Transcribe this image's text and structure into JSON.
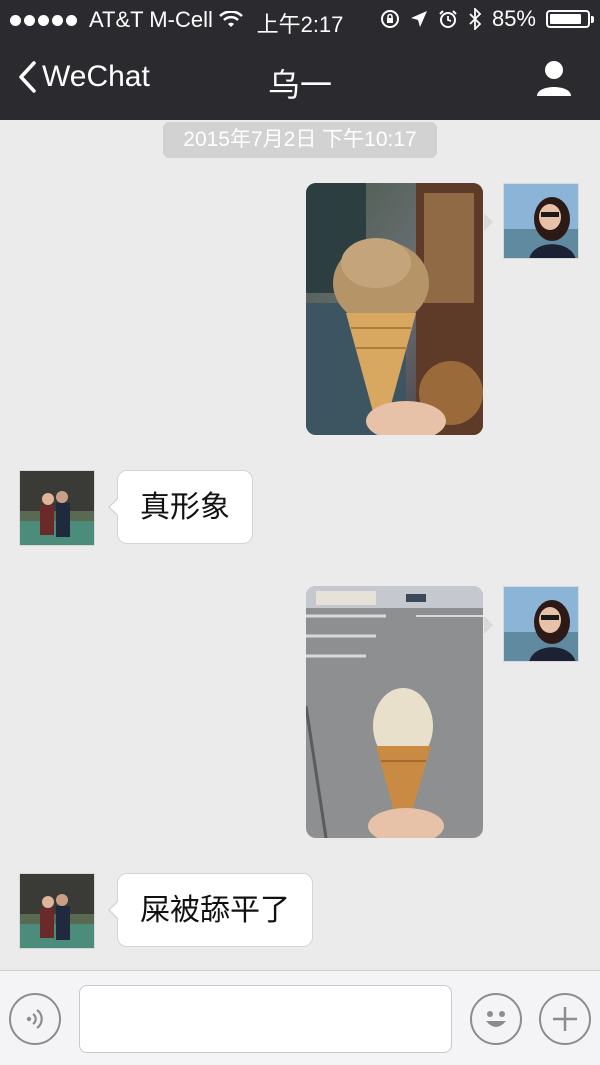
{
  "status_bar": {
    "carrier": "AT&T M-Cell",
    "time": "上午2:17",
    "battery": "85%",
    "battery_level": 0.85
  },
  "nav": {
    "back_label": "WeChat",
    "title": "乌一",
    "profile_icon": "person-icon"
  },
  "chat": {
    "timestamp": "2015年7月2日 下午10:17",
    "messages": [
      {
        "side": "right",
        "type": "image",
        "content": "ice-cream-photo-1"
      },
      {
        "side": "left",
        "type": "text",
        "text": "真形象"
      },
      {
        "side": "right",
        "type": "image",
        "content": "ice-cream-photo-2"
      },
      {
        "side": "left",
        "type": "text",
        "text": "屎被舔平了"
      }
    ]
  },
  "input_bar": {
    "voice_icon": "voice-icon",
    "text_value": "",
    "emoji_icon": "smiley-icon",
    "more_icon": "plus-icon"
  },
  "colors": {
    "nav_bg": "#2b2b2f",
    "chat_bg": "#ebebeb",
    "bubble_bg": "#ffffff"
  }
}
